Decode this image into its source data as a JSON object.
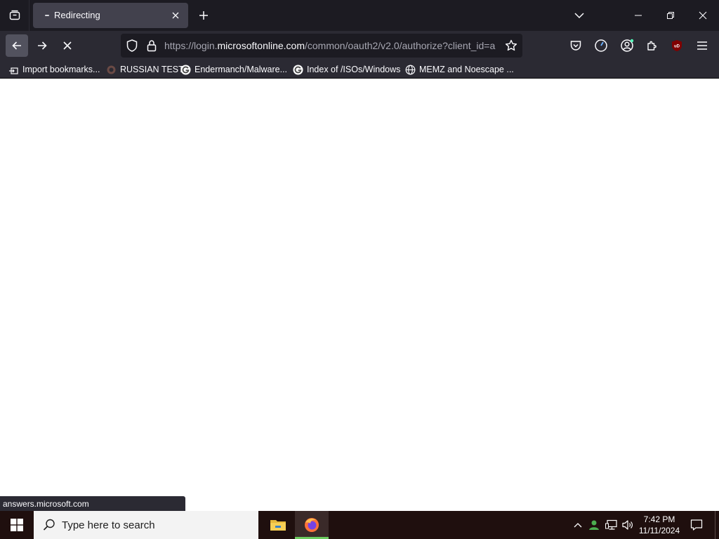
{
  "browser": {
    "tab": {
      "title": "Redirecting"
    },
    "url": {
      "prefix": "https://login.",
      "host": "microsoftonline.com",
      "path": "/common/oauth2/v2.0/authorize?client_id=a"
    },
    "bookmarks": [
      {
        "label": "Import bookmarks...",
        "icon": "import-icon"
      },
      {
        "label": "RUSSIAN TEST",
        "icon": "site-icon"
      },
      {
        "label": "Endermanch/Malware...",
        "icon": "google-icon"
      },
      {
        "label": "Index of /ISOs/Windows",
        "icon": "google-icon"
      },
      {
        "label": "MEMZ and Noescape ...",
        "icon": "globe-icon"
      }
    ],
    "status_url": "answers.microsoft.com"
  },
  "taskbar": {
    "search_placeholder": "Type here to search",
    "time": "7:42 PM",
    "date": "11/11/2024"
  },
  "colors": {
    "tabstrip": "#1c1b22",
    "toolbar": "#2b2a33",
    "urlbar": "#1c1b22",
    "taskbar": "#1f0f0e",
    "active_indicator": "#6ccb5f"
  }
}
